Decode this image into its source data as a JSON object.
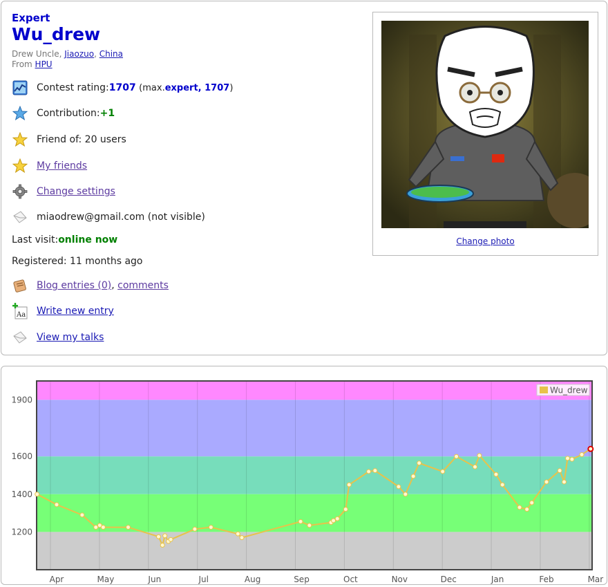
{
  "profile": {
    "rank": "Expert",
    "handle": "Wu_drew",
    "name_prefix": "Drew Uncle, ",
    "city": "Jiaozuo",
    "country": "China",
    "from_label": "From ",
    "organization": "HPU",
    "contest_rating_label": "Contest rating: ",
    "contest_rating": "1707",
    "max_prefix": "(max. ",
    "max_rank": "expert, 1707",
    "max_suffix": ")",
    "contribution_label": "Contribution: ",
    "contribution": "+1",
    "friend_of": "Friend of: 20 users",
    "my_friends": "My friends",
    "change_settings": "Change settings",
    "email": "miaodrew@gmail.com (not visible)",
    "last_visit_label": "Last visit: ",
    "last_visit": "online now",
    "registered": "Registered: 11 months ago",
    "blog_entries": "Blog entries (0)",
    "comments": "comments",
    "write_new_entry": "Write new entry",
    "view_my_talks": "View my talks",
    "change_photo": "Change photo"
  },
  "colors": {
    "rank_blue": "#0000cc",
    "online_green": "#008000",
    "line": "#e8c24a",
    "band_pink": "#ff88ff",
    "band_purple": "#aaaaff",
    "band_cyan": "#77ddbb",
    "band_green": "#77ff77",
    "band_gray": "#cccccc"
  },
  "chart_data": {
    "type": "line",
    "legend": "Wu_drew",
    "legend_position": "top-right",
    "x_ticks": [
      "Apr",
      "May",
      "Jun",
      "Jul",
      "Aug",
      "Sep",
      "Oct",
      "Nov",
      "Dec",
      "Jan",
      "Feb",
      "Mar"
    ],
    "y_ticks": [
      1200,
      1400,
      1600,
      1900
    ],
    "ylim": [
      1000,
      2000
    ],
    "bands": [
      {
        "from": 1900,
        "to": 2000,
        "color": "#ff88ff"
      },
      {
        "from": 1600,
        "to": 1900,
        "color": "#aaaaff"
      },
      {
        "from": 1400,
        "to": 1600,
        "color": "#77ddbb"
      },
      {
        "from": 1200,
        "to": 1400,
        "color": "#77ff77"
      },
      {
        "from": 1000,
        "to": 1200,
        "color": "#cccccc"
      }
    ],
    "series": [
      {
        "name": "Wu_drew",
        "x": [
          -0.4,
          0.0,
          0.52,
          0.8,
          0.88,
          0.95,
          1.46,
          2.08,
          2.16,
          2.21,
          2.28,
          2.33,
          2.82,
          3.15,
          3.7,
          3.78,
          4.98,
          5.16,
          5.6,
          5.65,
          5.73,
          5.9,
          5.97,
          6.37,
          6.5,
          6.98,
          7.12,
          7.28,
          7.4,
          7.88,
          8.16,
          8.54,
          8.63,
          8.97,
          9.1,
          9.45,
          9.6,
          9.7,
          10.0,
          10.27,
          10.36,
          10.43,
          10.52,
          10.72,
          10.9
        ],
        "y": [
          1400,
          1345,
          1290,
          1225,
          1235,
          1225,
          1225,
          1175,
          1130,
          1180,
          1150,
          1160,
          1215,
          1225,
          1190,
          1170,
          1255,
          1235,
          1250,
          1260,
          1270,
          1320,
          1450,
          1520,
          1525,
          1440,
          1400,
          1495,
          1565,
          1520,
          1600,
          1545,
          1605,
          1505,
          1450,
          1330,
          1320,
          1355,
          1465,
          1525,
          1465,
          1590,
          1585,
          1610,
          1640
        ]
      }
    ]
  }
}
